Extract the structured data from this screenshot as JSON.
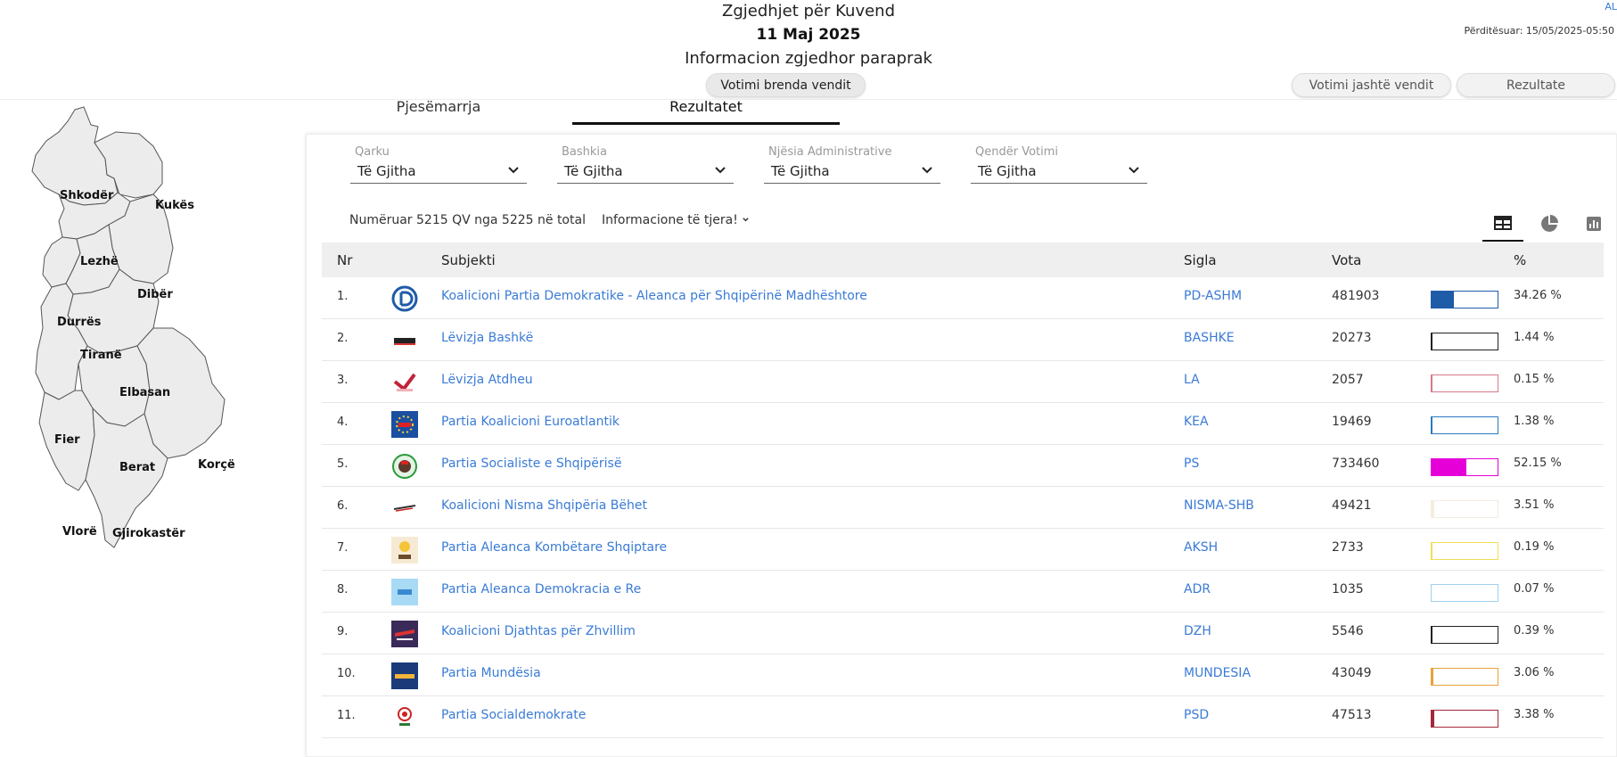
{
  "header": {
    "title": "Zgjedhjet për Kuvend",
    "date": "11 Maj 2025",
    "subtitle": "Informacion zgjedhor paraprak",
    "lang": "AL",
    "updated": "Përditësuar: 15/05/2025-05:50",
    "btn_inside": "Votimi brenda vendit",
    "btn_outside": "Votimi jashtë vendit",
    "btn_results": "Rezultate"
  },
  "map": {
    "regions": [
      "Shkodër",
      "Kukës",
      "Lezhë",
      "Dibër",
      "Durrës",
      "Tiranë",
      "Elbasan",
      "Fier",
      "Berat",
      "Korçë",
      "Vlorë",
      "Gjirokastër"
    ]
  },
  "tabs": {
    "participation": "Pjesëmarrja",
    "results": "Rezultatet"
  },
  "filters": [
    {
      "label": "Qarku",
      "value": "Të Gjitha"
    },
    {
      "label": "Bashkia",
      "value": "Të Gjitha"
    },
    {
      "label": "Njësia Administrative",
      "value": "Të Gjitha"
    },
    {
      "label": "Qendër Votimi",
      "value": "Të Gjitha"
    }
  ],
  "summary": {
    "count": "Numëruar 5215 QV nga 5225 në total",
    "more": "Informacione të tjera!"
  },
  "table": {
    "headers": {
      "nr": "Nr",
      "subject": "Subjekti",
      "sigla": "Sigla",
      "votes": "Vota",
      "pct": "%"
    },
    "rows": [
      {
        "nr": "1.",
        "name": "Koalicioni Partia Demokratike - Aleanca për Shqipërinë Madhështore",
        "sigla": "PD-ASHM",
        "votes": "481903",
        "pct": "34.26 %",
        "share": 0.3426,
        "color": "#1f5ca8",
        "logo": "pd-logo"
      },
      {
        "nr": "2.",
        "name": "Lëvizja Bashkë",
        "sigla": "BASHKE",
        "votes": "20273",
        "pct": "1.44 %",
        "share": 0.0144,
        "color": "#222222",
        "logo": "bashke-logo"
      },
      {
        "nr": "3.",
        "name": "Lëvizja Atdheu",
        "sigla": "LA",
        "votes": "2057",
        "pct": "0.15 %",
        "share": 0.0015,
        "color": "#d67a8a",
        "logo": "la-logo"
      },
      {
        "nr": "4.",
        "name": "Partia Koalicioni Euroatlantik",
        "sigla": "KEA",
        "votes": "19469",
        "pct": "1.38 %",
        "share": 0.0138,
        "color": "#2a7ac0",
        "logo": "kea-logo"
      },
      {
        "nr": "5.",
        "name": "Partia Socialiste e Shqipërisë",
        "sigla": "PS",
        "votes": "733460",
        "pct": "52.15 %",
        "share": 0.5215,
        "color": "#e600d8",
        "logo": "ps-logo"
      },
      {
        "nr": "6.",
        "name": "Koalicioni Nisma Shqipëria Bëhet",
        "sigla": "NISMA-SHB",
        "votes": "49421",
        "pct": "3.51 %",
        "share": 0.0351,
        "color": "#f3ece0",
        "logo": "nisma-logo"
      },
      {
        "nr": "7.",
        "name": "Partia Aleanca Kombëtare Shqiptare",
        "sigla": "AKSH",
        "votes": "2733",
        "pct": "0.19 %",
        "share": 0.0019,
        "color": "#f3dd55",
        "logo": "aksh-logo"
      },
      {
        "nr": "8.",
        "name": "Partia Aleanca Demokracia e Re",
        "sigla": "ADR",
        "votes": "1035",
        "pct": "0.07 %",
        "share": 0.0007,
        "color": "#9fd0f0",
        "logo": "adr-logo"
      },
      {
        "nr": "9.",
        "name": "Koalicioni Djathtas për Zhvillim",
        "sigla": "DZH",
        "votes": "5546",
        "pct": "0.39 %",
        "share": 0.0039,
        "color": "#222222",
        "logo": "dzh-logo"
      },
      {
        "nr": "10.",
        "name": "Partia Mundësia",
        "sigla": "MUNDESIA",
        "votes": "43049",
        "pct": "3.06 %",
        "share": 0.0306,
        "color": "#e8a23a",
        "logo": "mundesia-logo"
      },
      {
        "nr": "11.",
        "name": "Partia Socialdemokrate",
        "sigla": "PSD",
        "votes": "47513",
        "pct": "3.38 %",
        "share": 0.0338,
        "color": "#a3283a",
        "logo": "psd-logo"
      }
    ]
  }
}
